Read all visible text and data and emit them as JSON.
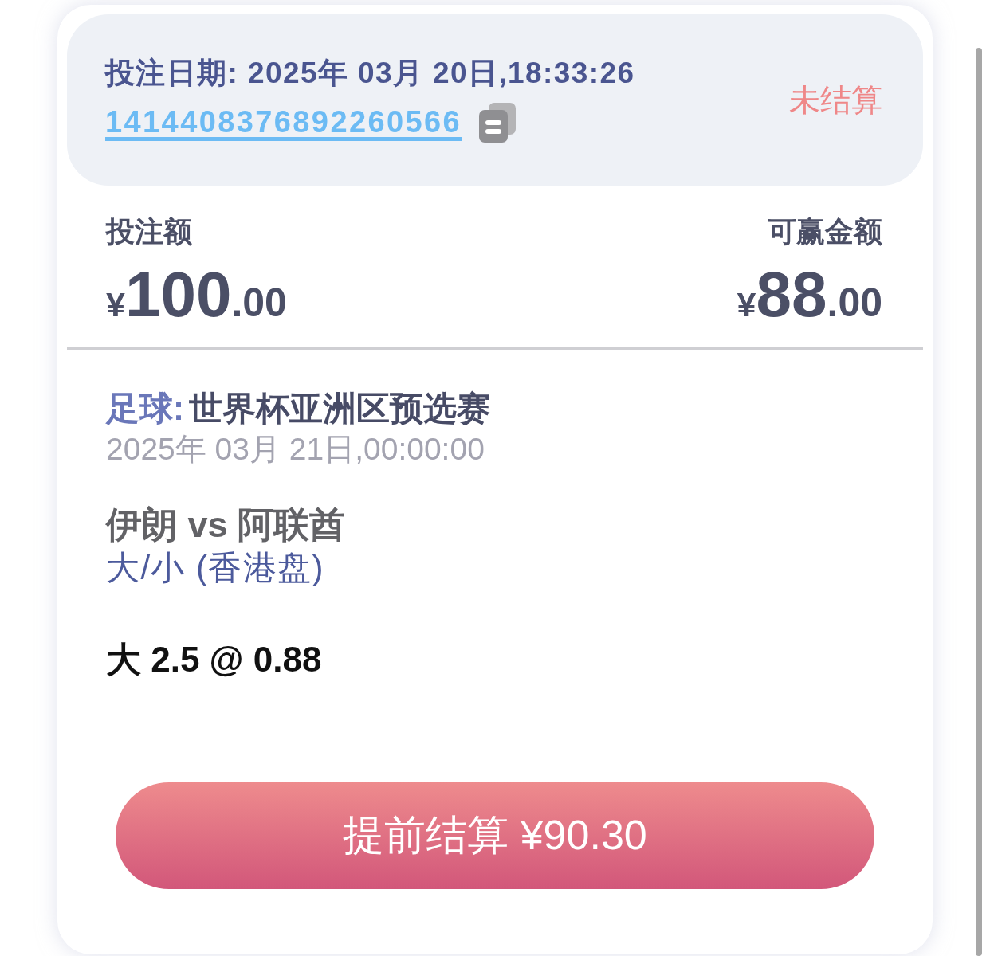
{
  "header": {
    "bet_date": "投注日期: 2025年 03月 20日,18:33:26",
    "bet_id": "1414408376892260566",
    "status": "未结算"
  },
  "amounts": [
    {
      "label": "投注额",
      "currency": "¥",
      "integer": "100",
      "fraction": ".00"
    },
    {
      "label": "可赢金额",
      "currency": "¥",
      "integer": "88",
      "fraction": ".00"
    }
  ],
  "match": {
    "sport": "足球:",
    "league": "世界杯亚洲区预选赛",
    "start_time": "2025年 03月 21日,00:00:00",
    "teams": "伊朗 vs 阿联酋",
    "market": "大/小 (香港盘)",
    "selection": "大 2.5 @ 0.88"
  },
  "cashout_button": {
    "label": "提前结算 ¥90.30"
  }
}
